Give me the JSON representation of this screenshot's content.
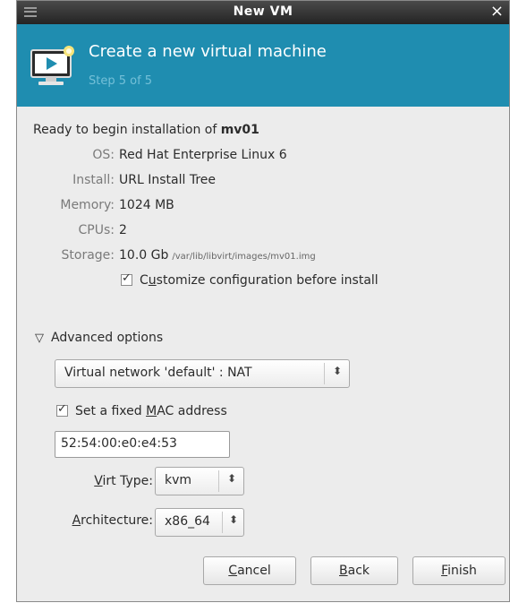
{
  "window": {
    "title": "New VM",
    "close_glyph": "×"
  },
  "banner": {
    "heading": "Create a new virtual machine",
    "step": "Step 5 of 5",
    "accent_color": "#1f8db0",
    "icon": "vm-monitor-icon"
  },
  "summary": {
    "ready_prefix": "Ready to begin installation of ",
    "vm_name": "mv01",
    "rows": [
      {
        "key": "OS:",
        "value": "Red Hat Enterprise Linux 6"
      },
      {
        "key": "Install:",
        "value": "URL Install Tree"
      },
      {
        "key": "Memory:",
        "value": "1024 MB"
      },
      {
        "key": "CPUs:",
        "value": "2"
      },
      {
        "key": "Storage:",
        "value": "10.0 Gb",
        "path": "/var/lib/libvirt/images/mv01.img"
      }
    ],
    "customize": {
      "checked": true,
      "pre": "C",
      "mnemonic": "u",
      "post": "stomize configuration before install"
    }
  },
  "advanced": {
    "label": "Advanced options",
    "expanded": true,
    "network": "Virtual network 'default' : NAT",
    "mac": {
      "checked": true,
      "pre": "Set a fixed ",
      "mnemonic": "M",
      "post": "AC address",
      "value": "52:54:00:e0:e4:53"
    },
    "virt_type": {
      "mnemonic": "V",
      "label_rest": "irt Type:",
      "value": "kvm"
    },
    "architecture": {
      "mnemonic": "A",
      "label_rest": "rchitecture:",
      "value": "x86_64"
    }
  },
  "buttons": {
    "cancel": {
      "mnemonic": "C",
      "rest": "ancel"
    },
    "back": {
      "mnemonic": "B",
      "rest": "ack"
    },
    "finish": {
      "mnemonic": "F",
      "rest": "inish"
    }
  }
}
